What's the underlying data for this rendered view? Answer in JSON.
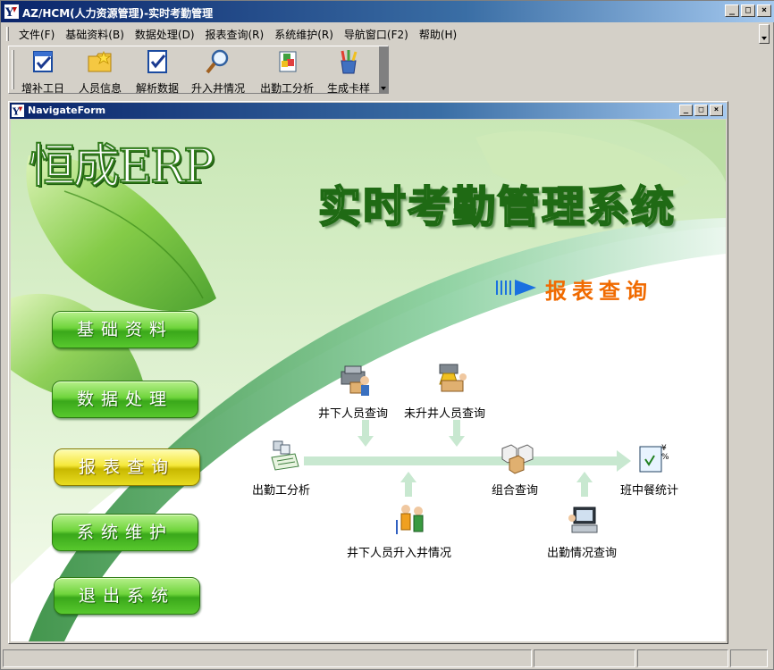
{
  "window": {
    "title": "AZ/HCM(人力资源管理)-实时考勤管理",
    "controls": {
      "minimize": "_",
      "maximize": "□",
      "close": "×"
    }
  },
  "menubar": {
    "items": [
      {
        "label": "文件(F)",
        "icon": null
      },
      {
        "label": "基础资料(B)"
      },
      {
        "label": "数据处理(D)"
      },
      {
        "label": "报表查询(R)"
      },
      {
        "label": "系统维护(R)"
      },
      {
        "label": "导航窗口(F2)"
      },
      {
        "label": "帮助(H)"
      }
    ]
  },
  "toolbar": {
    "buttons": [
      {
        "label": "增补工日",
        "icon": "calendar-check-icon"
      },
      {
        "label": "人员信息",
        "icon": "folder-star-icon"
      },
      {
        "label": "解析数据",
        "icon": "document-check-icon"
      },
      {
        "label": "升入井情况",
        "icon": "magnifier-icon"
      },
      {
        "label": "出勤工分析",
        "icon": "puzzle-document-icon"
      },
      {
        "label": "生成卡样",
        "icon": "pencil-cup-icon"
      }
    ]
  },
  "child_window": {
    "title": "NavigateForm",
    "controls": {
      "minimize": "_",
      "maximize": "□",
      "close": "×"
    }
  },
  "banner": {
    "brand": "恒成ERP",
    "system_title": "实时考勤管理系统",
    "section_title": "报表查询"
  },
  "nav": {
    "buttons": [
      {
        "label": "基础资料",
        "active": false
      },
      {
        "label": "数据处理",
        "active": false
      },
      {
        "label": "报表查询",
        "active": true
      },
      {
        "label": "系统维护",
        "active": false
      },
      {
        "label": "退出系统",
        "active": false
      }
    ]
  },
  "flow": {
    "nodes": {
      "underground": "井下人员查询",
      "not_up": "未升井人员查询",
      "attendance_analysis": "出勤工分析",
      "combined": "组合查询",
      "meal_stats": "班中餐统计",
      "shaft_inout": "井下人员升入井情况",
      "attendance_query": "出勤情况查询"
    }
  },
  "colors": {
    "title_gradient_start": "#0a246a",
    "title_gradient_end": "#a6caf0",
    "nav_green": "#58c82e",
    "nav_active_yellow": "#e8dc20",
    "brand_green": "#2f7a1a",
    "section_orange": "#f06a00",
    "flow_line": "#c8e8d0"
  }
}
